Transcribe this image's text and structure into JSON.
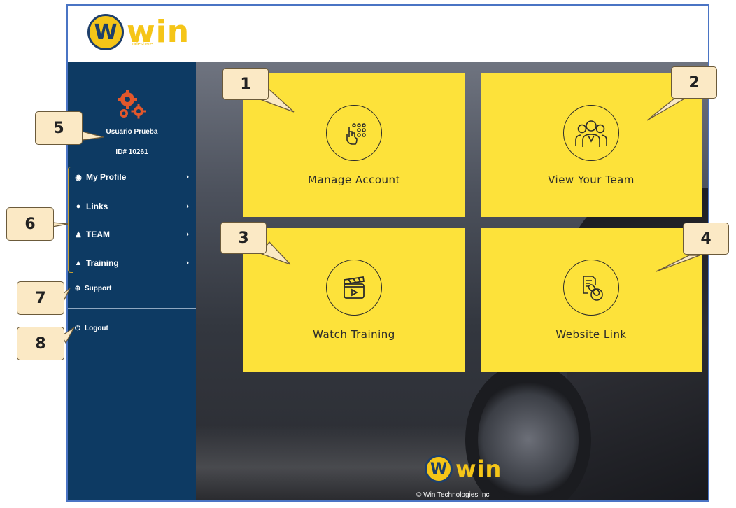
{
  "brand": {
    "word": "win",
    "sub": "rideshare",
    "letter": "W"
  },
  "sidebar": {
    "username": "Usuario Prueba",
    "user_id": "ID# 10261",
    "items": [
      {
        "label": "My Profile",
        "icon": "user-circle-icon"
      },
      {
        "label": "Links",
        "icon": "globe-icon"
      },
      {
        "label": "TEAM",
        "icon": "users-icon"
      },
      {
        "label": "Training",
        "icon": "graduation-cap-icon"
      }
    ],
    "support": "Support",
    "logout": "Logout",
    "chevron": "›"
  },
  "tiles": [
    {
      "label": "Manage Account",
      "icon": "hand-tap-icon"
    },
    {
      "label": "View Your Team",
      "icon": "team-icon"
    },
    {
      "label": "Watch Training",
      "icon": "clapperboard-icon"
    },
    {
      "label": "Website Link",
      "icon": "link-document-icon"
    }
  ],
  "footer": {
    "copyright": "© Win Technologies Inc"
  },
  "callouts": [
    "1",
    "2",
    "3",
    "4",
    "5",
    "6",
    "7",
    "8"
  ],
  "colors": {
    "sidebar": "#0d3a63",
    "tile": "#fde23a",
    "brand_yellow": "#f5c518",
    "gear": "#e2572b",
    "callout_bg": "#fbe9c5"
  }
}
